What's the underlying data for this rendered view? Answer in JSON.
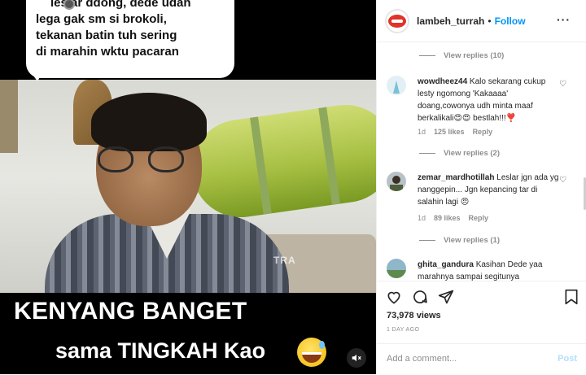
{
  "video": {
    "bubble_lines": [
      "leslar ddong, dede udah",
      "lega gak sm si brokoli,",
      "tekanan batin tuh sering",
      "di marahin wktu pacaran"
    ],
    "watermark": "TRA",
    "caption_line1": "KENYANG BANGET",
    "caption_line2": "sama TINGKAH Kao"
  },
  "header": {
    "username": "lambeh_turrah",
    "dot": "•",
    "follow_label": "Follow",
    "more_label": "···"
  },
  "comments": {
    "top_view_replies": "View replies (10)",
    "items": [
      {
        "user": "wowdheez44",
        "text": "Kalo sekarang cukup lesty ngomong 'Kakaaaa' doang,cowonya udh minta maaf berkalikali😍😍 bestlah!!!❣️",
        "time": "1d",
        "likes": "125 likes",
        "reply": "Reply",
        "view_replies": "View replies (2)"
      },
      {
        "user": "zemar_mardhotillah",
        "text": "Leslar jgn ada yg nanggepin... Jgn kepancing tar di salahin lagi 😠",
        "time": "1d",
        "likes": "89 likes",
        "reply": "Reply",
        "view_replies": "View replies (1)"
      },
      {
        "user": "ghita_gandura",
        "text": "Kasihan Dede yaa marahnya sampai segitunya"
      }
    ]
  },
  "actions": {
    "views": "73,978 views",
    "time_ago": "1 DAY AGO",
    "add_comment_placeholder": "Add a comment...",
    "post_label": "Post"
  },
  "colors": {
    "follow": "#0095f6",
    "muted": "#8e8e8e",
    "post_disabled": "#b2dffc"
  },
  "icons": [
    "heart-icon",
    "comment-icon",
    "share-icon",
    "save-icon",
    "mute-icon",
    "like-comment-icon",
    "more-options-icon"
  ]
}
